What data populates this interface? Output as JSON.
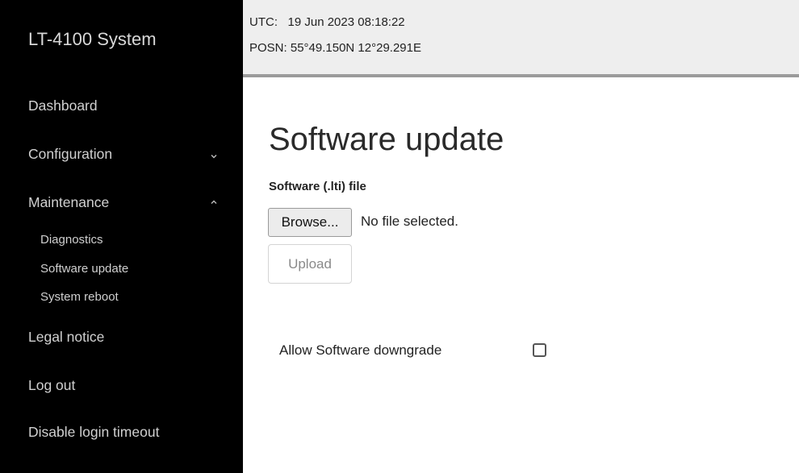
{
  "sidebar": {
    "brand": "LT-4100 System",
    "items": [
      {
        "label": "Dashboard"
      },
      {
        "label": "Configuration",
        "chevron": "chevron-down-icon"
      },
      {
        "label": "Maintenance",
        "chevron": "chevron-up-icon"
      },
      {
        "label": "Legal notice"
      },
      {
        "label": "Log out"
      },
      {
        "label": "Disable login timeout"
      }
    ],
    "maintenance_sub": [
      {
        "label": "Diagnostics"
      },
      {
        "label": "Software update"
      },
      {
        "label": "System reboot"
      }
    ]
  },
  "status": {
    "utc_label": "UTC:",
    "utc_value": "19 Jun 2023 08:18:22",
    "posn_label": "POSN:",
    "posn_value": "55°49.150N 12°29.291E"
  },
  "main": {
    "title": "Software update",
    "file_label": "Software (.lti) file",
    "browse_label": "Browse...",
    "no_file_text": "No file selected.",
    "upload_label": "Upload",
    "downgrade_label": "Allow Software downgrade",
    "downgrade_checked": false
  },
  "colors": {
    "sidebar_bg": "#000000",
    "topbar_bg": "#eeeeee"
  }
}
